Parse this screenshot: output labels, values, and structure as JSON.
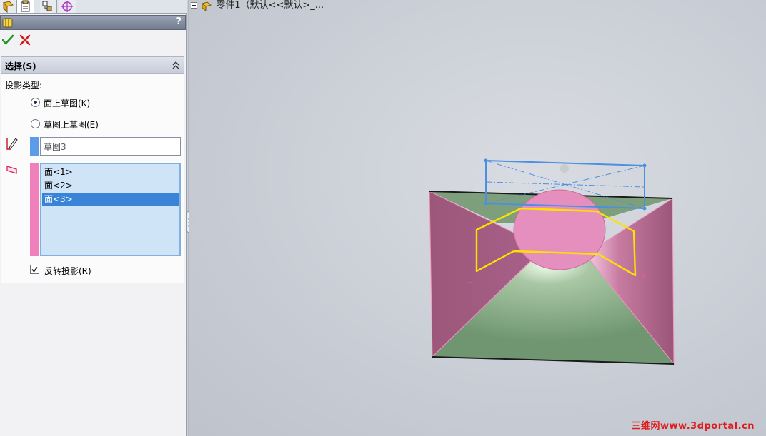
{
  "tree": {
    "root_label": "零件1（默认<<默认>_..."
  },
  "property_manager": {
    "help_glyph": "?",
    "group_title": "选择(S)",
    "projection_type_label": "投影类型:",
    "options": [
      {
        "label": "面上草图(K)",
        "checked": true
      },
      {
        "label": "草图上草图(E)",
        "checked": false
      }
    ],
    "sketch_field_value": "草图3",
    "faces": [
      "面<1>",
      "面<2>",
      "面<3>"
    ],
    "selected_face_index": 2,
    "reverse_label": "反转投影(R)",
    "reverse_checked": true
  },
  "colors": {
    "sketch_bar": "#5b9be8",
    "faces_bar": "#f080bc",
    "selection_highlight": "#3a84d8",
    "face_pink": "#a35b7f",
    "face_green": "#78a079",
    "sketch_yellow": "#ffe100",
    "sketch_blue": "#4a90e2"
  },
  "watermark": "三维网www.3dportal.cn",
  "icons": [
    "feature-manager-tab-icon",
    "property-manager-tab-icon",
    "configuration-manager-tab-icon",
    "dimxpert-tab-icon",
    "split-line-feature-icon",
    "ok-check-icon",
    "cancel-x-icon",
    "collapse-chevron-icon",
    "sketch-pencil-icon",
    "face-selection-icon",
    "expand-plus-icon",
    "part-icon"
  ]
}
